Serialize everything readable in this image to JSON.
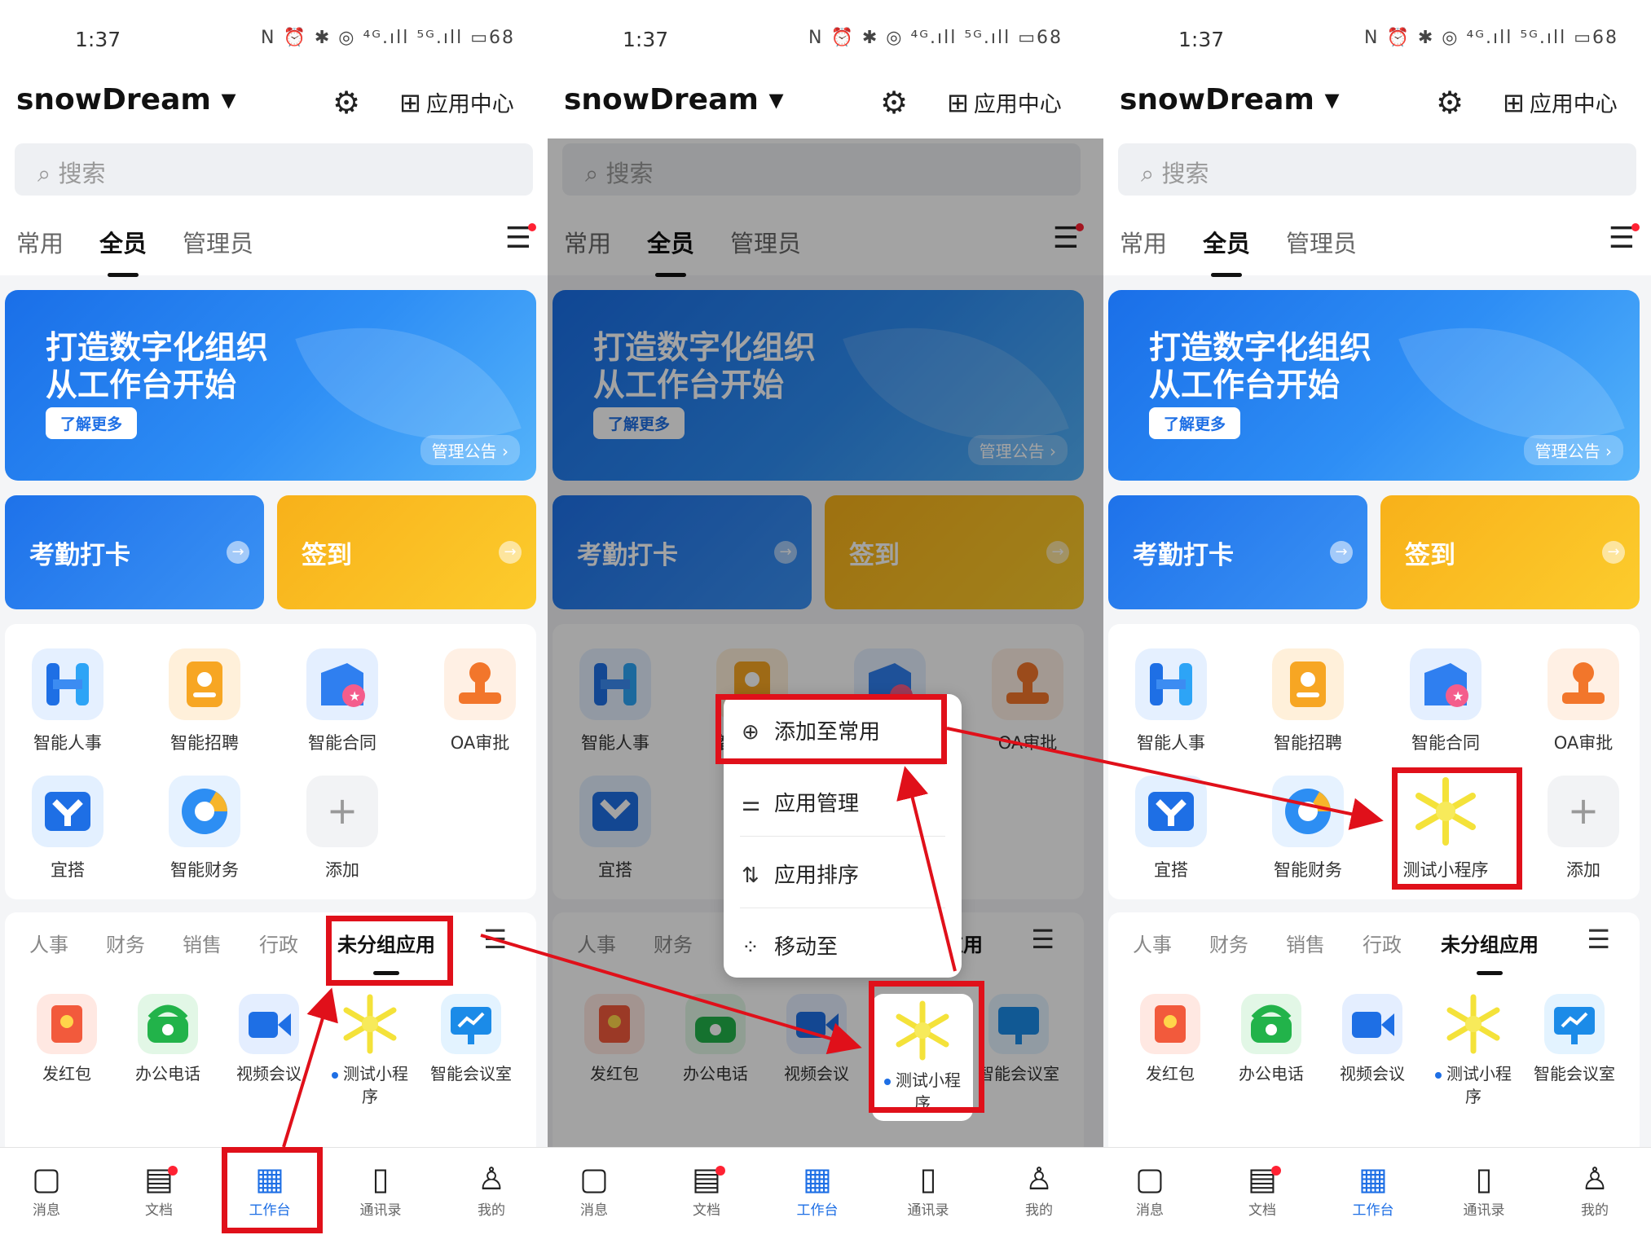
{
  "status": {
    "time": "1:37",
    "icons": "N ⏰ ✱ ◎ ⁴ᴳ.ıll ⁵ᴳ.ıll ▭68"
  },
  "header": {
    "org_name": "snowDream ▾",
    "app_center": "应用中心"
  },
  "search": {
    "placeholder": "搜索"
  },
  "tabs": [
    "常用",
    "全员",
    "管理员"
  ],
  "banner": {
    "line1": "打造数字化组织",
    "line2": "从工作台开始",
    "more_button": "了解更多",
    "notice_link": "管理公告 ›"
  },
  "quick": {
    "checkin": "考勤打卡",
    "signin": "签到",
    "arrow": "→"
  },
  "apps_panel1": [
    "智能人事",
    "智能招聘",
    "智能合同",
    "OA审批",
    "宜搭",
    "智能财务",
    "添加"
  ],
  "apps_panel3": [
    "智能人事",
    "智能招聘",
    "智能合同",
    "OA审批",
    "宜搭",
    "智能财务",
    "测试小程序",
    "添加"
  ],
  "group_tabs": [
    "人事",
    "财务",
    "销售",
    "行政",
    "未分组应用"
  ],
  "group_apps": [
    "发红包",
    "办公电话",
    "视频会议",
    "测试小程\n序",
    "智能会议室"
  ],
  "context_menu": [
    "添加至常用",
    "应用管理",
    "应用排序",
    "移动至"
  ],
  "bottom_nav": [
    "消息",
    "文档",
    "工作台",
    "通讯录",
    "我的"
  ],
  "colors": {
    "brand_blue": "#1e6fe5",
    "highlight_red": "#e0101a",
    "sign_yellow": "#f8b11a"
  }
}
